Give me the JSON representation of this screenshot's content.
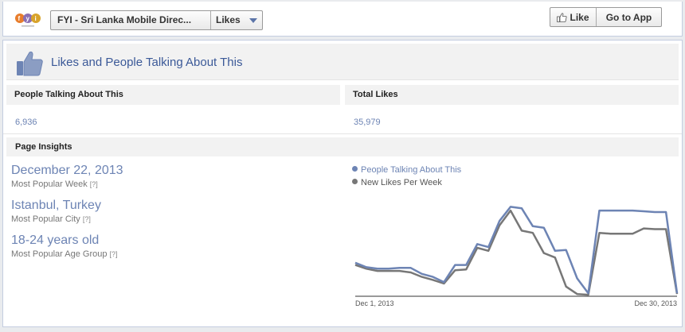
{
  "header": {
    "page_name": "FYI - Sri Lanka Mobile Direc...",
    "section": "Likes",
    "like_button": "Like",
    "go_to_app": "Go to App"
  },
  "panel": {
    "title": "Likes and People Talking About This",
    "people_talking_header": "People Talking About This",
    "people_talking_value": "6,936",
    "total_likes_header": "Total Likes",
    "total_likes_value": "35,979",
    "insights_header": "Page Insights",
    "insights": [
      {
        "value": "December 22, 2013",
        "label": "Most Popular Week",
        "help": "[?]"
      },
      {
        "value": "Istanbul, Turkey",
        "label": "Most Popular City",
        "help": "[?]"
      },
      {
        "value": "18-24 years old",
        "label": "Most Popular Age Group",
        "help": "[?]"
      }
    ]
  },
  "colors": {
    "people_talking": "#6d84b4",
    "new_likes": "#777777",
    "link": "#3b5998"
  },
  "chart_data": {
    "type": "line",
    "x_start_label": "Dec 1, 2013",
    "x_end_label": "Dec 30, 2013",
    "series": [
      {
        "name": "People Talking About This",
        "color": "#6d84b4",
        "values": [
          45,
          39,
          37,
          37,
          38,
          38,
          30,
          26,
          19,
          42,
          42,
          70,
          66,
          101,
          120,
          118,
          94,
          92,
          61,
          62,
          24,
          4,
          115,
          115,
          115,
          115,
          114,
          113,
          113,
          4
        ]
      },
      {
        "name": "New Likes Per Week",
        "color": "#777777",
        "values": [
          42,
          37,
          34,
          34,
          34,
          32,
          26,
          22,
          17,
          35,
          36,
          65,
          61,
          95,
          115,
          88,
          85,
          58,
          52,
          13,
          3,
          2,
          85,
          84,
          84,
          84,
          91,
          90,
          90,
          3
        ]
      }
    ],
    "ylim": [
      0,
      130
    ],
    "grid": false,
    "legend_position": "top-left"
  }
}
